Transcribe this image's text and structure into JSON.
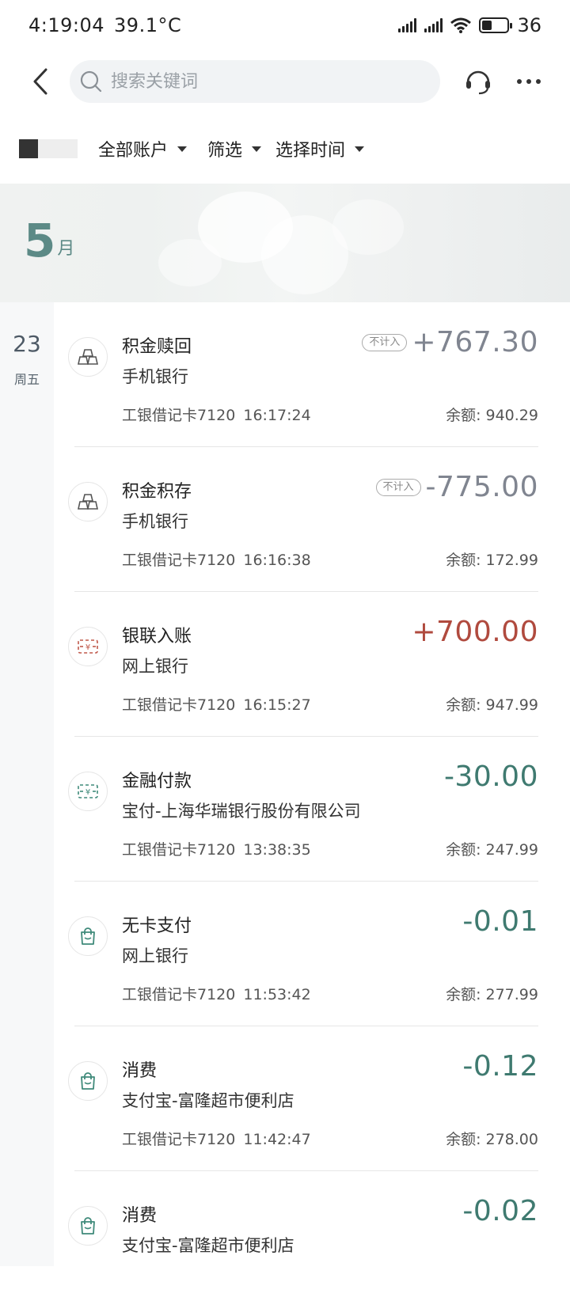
{
  "status_bar": {
    "time": "4:19:04",
    "temperature": "39.1°C",
    "battery_level": "36"
  },
  "search": {
    "placeholder": "搜索关键词"
  },
  "filters": {
    "all_accounts": "全部账户",
    "filter": "筛选",
    "select_time": "选择时间"
  },
  "month": {
    "number": "5",
    "unit": "月"
  },
  "date_group": {
    "day": "23",
    "weekday": "周五"
  },
  "transactions": [
    {
      "title": "积金赎回",
      "channel": "手机银行",
      "card": "工银借记卡7120",
      "time": "16:17:24",
      "badge": "不计入",
      "amount": "+767.30",
      "amount_color": "#808590",
      "balance": "余额: 940.29",
      "icon": "gold-bars-icon"
    },
    {
      "title": "积金积存",
      "channel": "手机银行",
      "card": "工银借记卡7120",
      "time": "16:16:38",
      "badge": "不计入",
      "amount": "-775.00",
      "amount_color": "#808590",
      "balance": "余额: 172.99",
      "icon": "gold-bars-icon"
    },
    {
      "title": "银联入账",
      "channel": "网上银行",
      "card": "工银借记卡7120",
      "time": "16:15:27",
      "amount": "+700.00",
      "amount_color": "#b04a3e",
      "balance": "余额: 947.99",
      "icon": "yuan-transfer-in-icon"
    },
    {
      "title": "金融付款",
      "channel": "宝付-上海华瑞银行股份有限公司",
      "card": "工银借记卡7120",
      "time": "13:38:35",
      "amount": "-30.00",
      "amount_color": "#3f7a70",
      "balance": "余额: 247.99",
      "icon": "yuan-transfer-out-icon"
    },
    {
      "title": "无卡支付",
      "channel": "网上银行",
      "card": "工银借记卡7120",
      "time": "11:53:42",
      "amount": "-0.01",
      "amount_color": "#3f7a70",
      "balance": "余额: 277.99",
      "icon": "shopping-bag-icon"
    },
    {
      "title": "消费",
      "channel": "支付宝-富隆超市便利店",
      "card": "工银借记卡7120",
      "time": "11:42:47",
      "amount": "-0.12",
      "amount_color": "#3f7a70",
      "balance": "余额: 278.00",
      "icon": "shopping-bag-icon"
    },
    {
      "title": "消费",
      "channel": "支付宝-富隆超市便利店",
      "amount": "-0.02",
      "amount_color": "#3f7a70",
      "icon": "shopping-bag-icon"
    }
  ]
}
